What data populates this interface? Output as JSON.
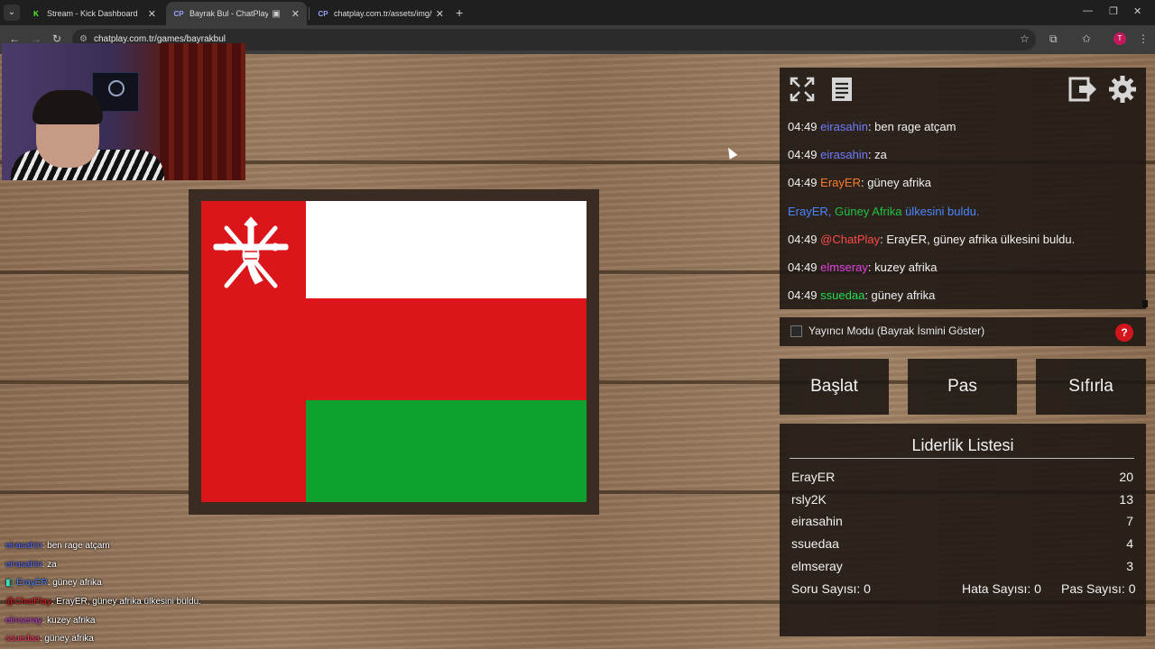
{
  "browser": {
    "tabs": [
      {
        "title": "Stream - Kick Dashboard",
        "favicon": "K",
        "favicon_color": "#53fc18",
        "active": false
      },
      {
        "title": "Bayrak Bul - ChatPlay",
        "favicon": "CP",
        "favicon_color": "#9aa0ff",
        "active": true
      },
      {
        "title": "chatplay.com.tr/assets/img/fla...",
        "favicon": "CP",
        "favicon_color": "#9aa0ff",
        "active": false
      }
    ],
    "new_tab": "+",
    "url": "chatplay.com.tr/games/bayrakbul",
    "profile_initial": "T"
  },
  "flag": {
    "colors": {
      "white": "#ffffff",
      "red": "#db161b",
      "green": "#0ea12d"
    }
  },
  "chat": {
    "messages": [
      {
        "time": "04:49",
        "user": "eirasahin",
        "user_color": "#6e7cff",
        "text": ": ben rage atçam"
      },
      {
        "time": "04:49",
        "user": "eirasahin",
        "user_color": "#6e7cff",
        "text": ": za"
      },
      {
        "time": "04:49",
        "user": "ErayER",
        "user_color": "#ff7a2e",
        "text": ": güney afrika"
      },
      {
        "time": "",
        "user": "ErayER",
        "user_color": "#4a86ff",
        "text": ", ",
        "country": "Güney Afrika",
        "country_color": "#20c040",
        "suffix": " ülkesini buldu.",
        "suffix_color": "#4a86ff"
      },
      {
        "time": "04:49",
        "user": "@ChatPlay",
        "user_color": "#ff4a4a",
        "text": ": ErayER, güney afrika ülkesini buldu."
      },
      {
        "time": "04:49",
        "user": "elmseray",
        "user_color": "#e040e0",
        "text": ": kuzey afrika"
      },
      {
        "time": "04:49",
        "user": "ssuedaa",
        "user_color": "#22dd55",
        "text": ": güney afrika"
      }
    ]
  },
  "controls": {
    "streamer_mode_label": "Yayıncı Modu (Bayrak İsmini Göster)",
    "help_label": "?",
    "start_label": "Başlat",
    "pass_label": "Pas",
    "reset_label": "Sıfırla"
  },
  "leaderboard": {
    "title": "Liderlik Listesi",
    "entries": [
      {
        "name": "ErayER",
        "score": "20"
      },
      {
        "name": "rsly2K",
        "score": "13"
      },
      {
        "name": "eirasahin",
        "score": "7"
      },
      {
        "name": "ssuedaa",
        "score": "4"
      },
      {
        "name": "elmseray",
        "score": "3"
      }
    ],
    "stats": {
      "questions": "Soru Sayısı: 0",
      "errors": "Hata Sayısı: 0",
      "passes": "Pas Sayısı: 0"
    }
  },
  "overlay_chat": [
    {
      "user": "eirasahin",
      "user_color": "#5b6cff",
      "text": ": ben rage atçam"
    },
    {
      "user": "eirasahin",
      "user_color": "#5b6cff",
      "text": ": za"
    },
    {
      "user": "ErayER",
      "user_color": "#4a86ff",
      "text": ": güney afrika"
    },
    {
      "user": "@ChatPlay",
      "user_color": "#e0202a",
      "text": ": ErayER, güney afrika ülkesini buldu."
    },
    {
      "user": "elmseray",
      "user_color": "#c040d0",
      "text": ": kuzey afrika"
    },
    {
      "user": "ssuedaa",
      "user_color": "#ff3a6a",
      "text": ": güney afrika"
    }
  ]
}
